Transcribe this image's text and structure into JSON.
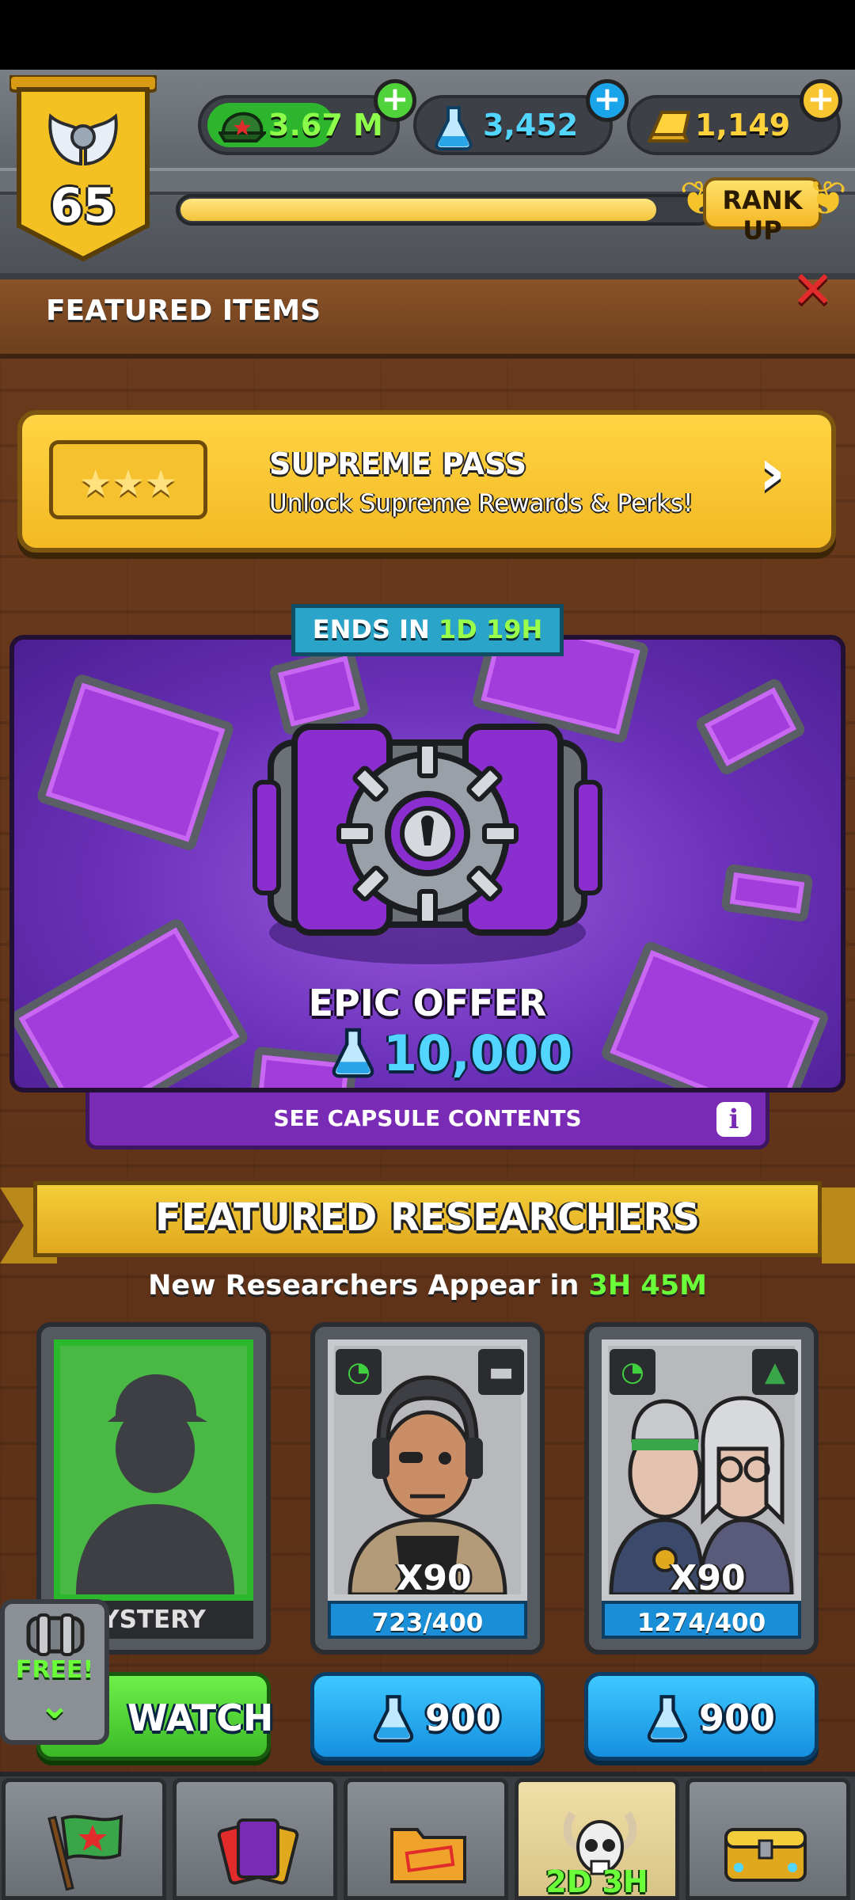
{
  "header": {
    "rank_level": "65",
    "currencies": {
      "cash": "3.67 M",
      "flasks": "3,452",
      "gold": "1,149"
    },
    "rank_progress": 0.9,
    "rank_up_label": "RANK UP"
  },
  "featured": {
    "title": "FEATURED ITEMS"
  },
  "supreme_pass": {
    "title": "SUPREME PASS",
    "subtitle": "Unlock Supreme Rewards & Perks!",
    "stars": "★★★"
  },
  "epic_offer": {
    "ends_label": "ENDS IN",
    "ends_days": "1D",
    "ends_hours": "19H",
    "title": "EPIC OFFER",
    "price": "10,000",
    "contents_label": "SEE CAPSULE CONTENTS",
    "info_symbol": "i"
  },
  "researchers": {
    "title": "FEATURED RESEARCHERS",
    "subtitle_prefix": "New Researchers Appear in",
    "subtitle_time": "3H 45M",
    "cards": [
      {
        "label": "YSTERY",
        "button": "WATCH"
      },
      {
        "multiplier": "X90",
        "progress": "723/400",
        "price": "900"
      },
      {
        "multiplier": "X90",
        "progress": "1274/400",
        "price": "900"
      }
    ],
    "free_label": "FREE!"
  },
  "bottom_nav": {
    "timer": "2D 3H"
  },
  "colors": {
    "flask_blue": "#52d5ff",
    "cash_green": "#8dff4a",
    "gold_yellow": "#ffd23c",
    "offer_purple": "#6a30b8"
  }
}
